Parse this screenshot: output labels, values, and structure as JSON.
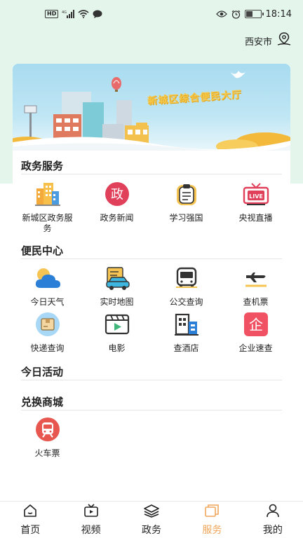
{
  "status_bar": {
    "network_badge": "HD",
    "network_type": "4G",
    "time": "18:14"
  },
  "location": {
    "city": "西安市"
  },
  "banner": {
    "title": "新城区综合便民大厅"
  },
  "sections": {
    "gov": {
      "title": "政务服务",
      "items": [
        {
          "label": "新城区政务服务",
          "icon": "building-icon"
        },
        {
          "label": "政务新闻",
          "icon": "gov-news-icon",
          "glyph": "政"
        },
        {
          "label": "学习强国",
          "icon": "clipboard-icon"
        },
        {
          "label": "央视直播",
          "icon": "tv-live-icon",
          "glyph": "LIVE"
        }
      ]
    },
    "life": {
      "title": "便民中心",
      "items": [
        {
          "label": "今日天气",
          "icon": "weather-icon"
        },
        {
          "label": "实时地图",
          "icon": "map-car-icon"
        },
        {
          "label": "公交查询",
          "icon": "bus-icon"
        },
        {
          "label": "查机票",
          "icon": "plane-icon"
        },
        {
          "label": "快递查询",
          "icon": "parcel-icon"
        },
        {
          "label": "电影",
          "icon": "movie-icon"
        },
        {
          "label": "查酒店",
          "icon": "hotel-icon"
        },
        {
          "label": "企业速查",
          "icon": "enterprise-icon",
          "glyph": "企"
        }
      ]
    },
    "today": {
      "title": "今日活动"
    },
    "mall": {
      "title": "兑换商城",
      "items": [
        {
          "label": "火车票",
          "icon": "train-icon"
        }
      ]
    }
  },
  "tabs": [
    {
      "label": "首页",
      "icon": "home-icon",
      "active": false
    },
    {
      "label": "视频",
      "icon": "video-icon",
      "active": false
    },
    {
      "label": "政务",
      "icon": "layers-icon",
      "active": false
    },
    {
      "label": "服务",
      "icon": "service-icon",
      "active": true
    },
    {
      "label": "我的",
      "icon": "profile-icon",
      "active": false
    }
  ],
  "colors": {
    "accent": "#f0a65a",
    "header_bg": "#e4f5ec",
    "gov_red": "#e83e54",
    "enterprise_red": "#f05263",
    "train_red": "#e8574f"
  }
}
